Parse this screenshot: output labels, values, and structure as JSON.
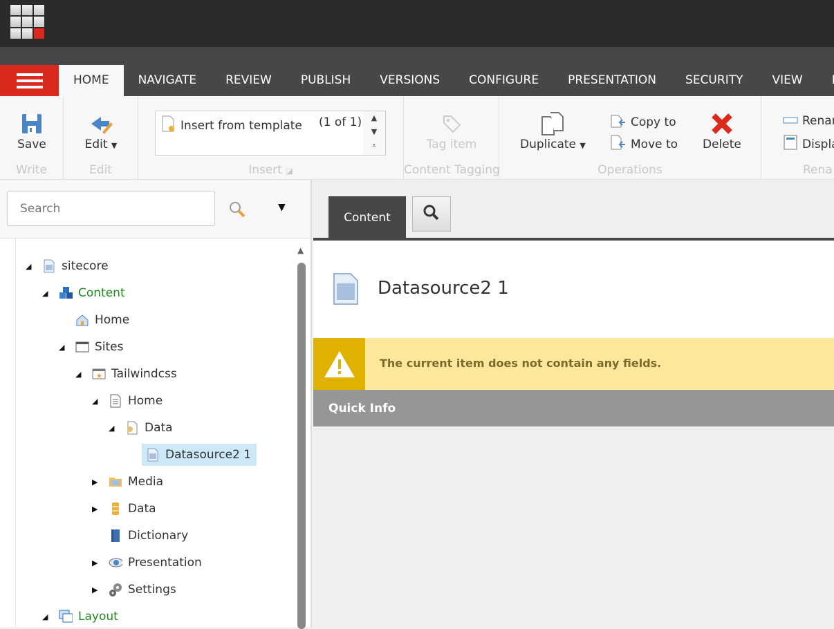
{
  "colors": {
    "accent": "#dc291e",
    "dark": "#474747",
    "warning": "#fce79a",
    "warning_icon": "#e0b100",
    "tree_green": "#1f8b1f",
    "selected": "#cde8f7"
  },
  "tabs": [
    "HOME",
    "NAVIGATE",
    "REVIEW",
    "PUBLISH",
    "VERSIONS",
    "CONFIGURE",
    "PRESENTATION",
    "SECURITY",
    "VIEW",
    "M"
  ],
  "ribbon": {
    "write": {
      "save": "Save",
      "group": "Write"
    },
    "edit": {
      "edit": "Edit",
      "group": "Edit"
    },
    "insert": {
      "item": "Insert from template",
      "count": "(1 of 1)",
      "group": "Insert"
    },
    "tagging": {
      "tag": "Tag item",
      "group": "Content Tagging"
    },
    "operations": {
      "duplicate": "Duplicate",
      "copy": "Copy to",
      "move": "Move to",
      "delete": "Delete",
      "group": "Operations"
    },
    "rename": {
      "rename": "Renar",
      "display": "Displa",
      "group": "Rena"
    }
  },
  "search": {
    "placeholder": "Search"
  },
  "tree": [
    {
      "label": "sitecore",
      "level": 0,
      "state": "expanded",
      "icon": "document-icon"
    },
    {
      "label": "Content",
      "level": 1,
      "state": "expanded",
      "icon": "cubes-icon",
      "green": true
    },
    {
      "label": "Home",
      "level": 2,
      "state": "none",
      "icon": "house-icon"
    },
    {
      "label": "Sites",
      "level": 2,
      "state": "expanded",
      "icon": "window-icon"
    },
    {
      "label": "Tailwindcss",
      "level": 3,
      "state": "expanded",
      "icon": "star-window-icon"
    },
    {
      "label": "Home",
      "level": 4,
      "state": "expanded",
      "icon": "page-icon"
    },
    {
      "label": "Data",
      "level": 5,
      "state": "expanded",
      "icon": "data-folder-icon"
    },
    {
      "label": "Datasource2 1",
      "level": 6,
      "state": "none",
      "icon": "document-icon",
      "selected": true
    },
    {
      "label": "Media",
      "level": 4,
      "state": "collapsed",
      "icon": "folder-icon"
    },
    {
      "label": "Data",
      "level": 4,
      "state": "collapsed",
      "icon": "database-icon"
    },
    {
      "label": "Dictionary",
      "level": 4,
      "state": "none",
      "icon": "book-icon"
    },
    {
      "label": "Presentation",
      "level": 4,
      "state": "collapsed",
      "icon": "eye-icon"
    },
    {
      "label": "Settings",
      "level": 4,
      "state": "collapsed",
      "icon": "gears-icon"
    },
    {
      "label": "Layout",
      "level": 1,
      "state": "expanded",
      "icon": "layout-icon",
      "green": true
    }
  ],
  "editor": {
    "content_tab": "Content",
    "item_title": "Datasource2 1",
    "warning": "The current item does not contain any fields.",
    "quick_info": "Quick Info"
  }
}
